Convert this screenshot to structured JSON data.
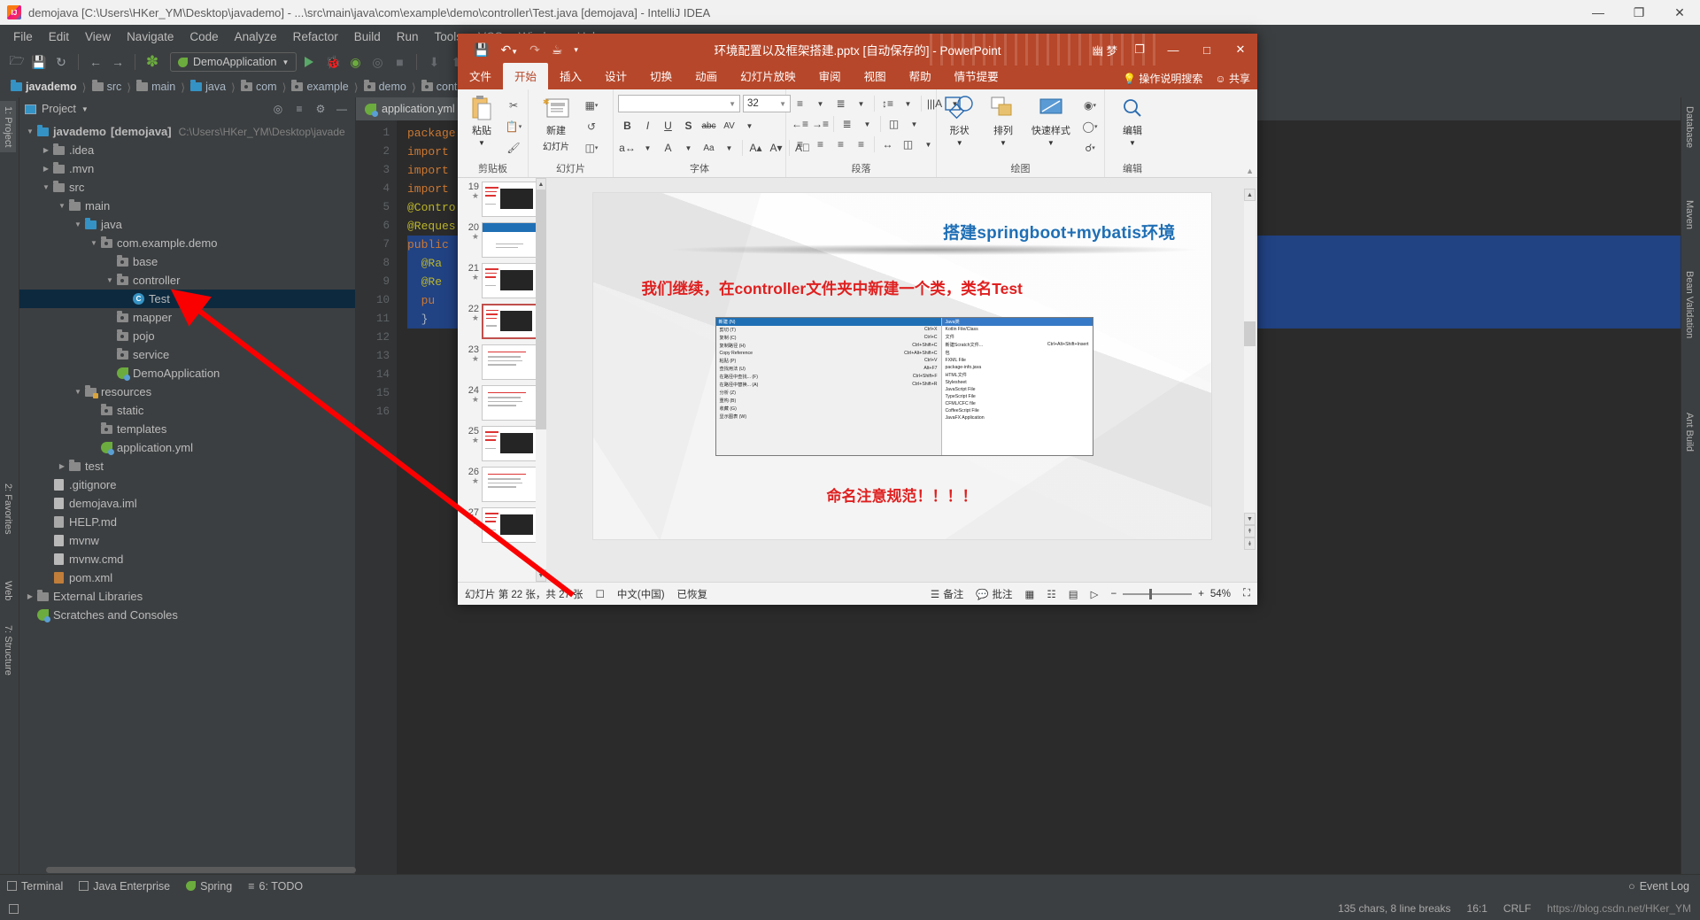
{
  "ide": {
    "title": "demojava [C:\\Users\\HKer_YM\\Desktop\\javademo] - ...\\src\\main\\java\\com\\example\\demo\\controller\\Test.java [demojava] - IntelliJ IDEA",
    "window_buttons": {
      "minimize": "—",
      "maximize": "❐",
      "close": "✕"
    },
    "menus": [
      "File",
      "Edit",
      "View",
      "Navigate",
      "Code",
      "Analyze",
      "Refactor",
      "Build",
      "Run",
      "Tools",
      "VCS",
      "Window",
      "Help"
    ],
    "toolbar": {
      "run_config": "DemoApplication"
    },
    "breadcrumbs": [
      "javademo",
      "src",
      "main",
      "java",
      "com",
      "example",
      "demo",
      "controller"
    ],
    "project_panel": {
      "header": "Project",
      "tree": [
        {
          "depth": 0,
          "arrow": "▼",
          "icon": "module",
          "label": "javademo",
          "bracket": "[demojava]",
          "path": "C:\\Users\\HKer_YM\\Desktop\\javade",
          "bold": true
        },
        {
          "depth": 1,
          "arrow": "▶",
          "icon": "folder",
          "label": ".idea"
        },
        {
          "depth": 1,
          "arrow": "▶",
          "icon": "folder",
          "label": ".mvn"
        },
        {
          "depth": 1,
          "arrow": "▼",
          "icon": "folder",
          "label": "src"
        },
        {
          "depth": 2,
          "arrow": "▼",
          "icon": "folder",
          "label": "main"
        },
        {
          "depth": 3,
          "arrow": "▼",
          "icon": "folder-blue",
          "label": "java"
        },
        {
          "depth": 4,
          "arrow": "▼",
          "icon": "package",
          "label": "com.example.demo"
        },
        {
          "depth": 5,
          "arrow": "",
          "icon": "package",
          "label": "base"
        },
        {
          "depth": 5,
          "arrow": "▼",
          "icon": "package",
          "label": "controller"
        },
        {
          "depth": 6,
          "arrow": "",
          "icon": "class",
          "label": "Test",
          "selected": true
        },
        {
          "depth": 5,
          "arrow": "",
          "icon": "package",
          "label": "mapper"
        },
        {
          "depth": 5,
          "arrow": "",
          "icon": "package",
          "label": "pojo"
        },
        {
          "depth": 5,
          "arrow": "",
          "icon": "package",
          "label": "service"
        },
        {
          "depth": 5,
          "arrow": "",
          "icon": "spring",
          "label": "DemoApplication"
        },
        {
          "depth": 3,
          "arrow": "▼",
          "icon": "resources",
          "label": "resources"
        },
        {
          "depth": 4,
          "arrow": "",
          "icon": "package",
          "label": "static"
        },
        {
          "depth": 4,
          "arrow": "",
          "icon": "package",
          "label": "templates"
        },
        {
          "depth": 4,
          "arrow": "",
          "icon": "spring",
          "label": "application.yml"
        },
        {
          "depth": 2,
          "arrow": "▶",
          "icon": "folder",
          "label": "test"
        },
        {
          "depth": 1,
          "arrow": "",
          "icon": "file",
          "label": ".gitignore"
        },
        {
          "depth": 1,
          "arrow": "",
          "icon": "iml",
          "label": "demojava.iml"
        },
        {
          "depth": 1,
          "arrow": "",
          "icon": "md",
          "label": "HELP.md"
        },
        {
          "depth": 1,
          "arrow": "",
          "icon": "file",
          "label": "mvnw"
        },
        {
          "depth": 1,
          "arrow": "",
          "icon": "file",
          "label": "mvnw.cmd"
        },
        {
          "depth": 1,
          "arrow": "",
          "icon": "xml",
          "label": "pom.xml"
        },
        {
          "depth": 0,
          "arrow": "▶",
          "icon": "lib",
          "label": "External Libraries"
        },
        {
          "depth": 0,
          "arrow": "",
          "icon": "scratch",
          "label": "Scratches and Consoles"
        }
      ]
    },
    "editor": {
      "tab": "application.yml",
      "gutter": [
        "1",
        "2",
        "3",
        "4",
        "5",
        "6",
        "7",
        "8",
        "9",
        "10",
        "11",
        "12",
        "13",
        "14",
        "15",
        "16"
      ],
      "lines": [
        "package",
        "",
        "import",
        "import",
        "import",
        "",
        "@Contro",
        "@Reques",
        "public",
        "  @Ra",
        "  @Re",
        "  pu",
        "",
        "",
        "  }",
        ""
      ]
    },
    "left_rail": [
      "1: Project",
      "2: Favorites",
      "Web",
      "7: Structure"
    ],
    "right_rail": [
      "Database",
      "Maven",
      "Bean Validation",
      "Ant Build"
    ],
    "status_tools": [
      "Terminal",
      "Java Enterprise",
      "Spring",
      "6: TODO"
    ],
    "status_right": "Event Log",
    "status_line": {
      "chars": "135 chars, 8 line breaks",
      "caret": "16:1",
      "lineending": "CRLF",
      "encoding": ""
    },
    "watermark": "https://blog.csdn.net/HKer_YM"
  },
  "ppt": {
    "title": "环境配置以及框架搭建.pptx [自动保存的]  -  PowerPoint",
    "qat": [
      "save-icon",
      "undo-icon",
      "redo-icon",
      "present-icon",
      "more-icon"
    ],
    "user": "幽 梦",
    "window_buttons": {
      "ribbon": "❐",
      "minimize": "—",
      "maximize": "□",
      "close": "✕"
    },
    "tabs": [
      "文件",
      "开始",
      "插入",
      "设计",
      "切换",
      "动画",
      "幻灯片放映",
      "审阅",
      "视图",
      "帮助",
      "情节提要"
    ],
    "active_tab": "开始",
    "tell_me": "操作说明搜索",
    "share": "共享",
    "ribbon_groups": [
      {
        "label": "剪贴板",
        "buttons": [
          "粘贴"
        ]
      },
      {
        "label": "幻灯片",
        "buttons": [
          "新建",
          "幻灯片"
        ]
      },
      {
        "label": "字体",
        "font_name": "",
        "font_size": "32"
      },
      {
        "label": "段落"
      },
      {
        "label": "绘图",
        "buttons": [
          "形状",
          "排列",
          "快速样式"
        ]
      },
      {
        "label": "编辑",
        "buttons": [
          "编辑"
        ]
      }
    ],
    "thumbnails": [
      {
        "num": "19",
        "star": "★",
        "type": "code"
      },
      {
        "num": "20",
        "star": "★",
        "type": "title"
      },
      {
        "num": "21",
        "star": "★",
        "type": "code"
      },
      {
        "num": "22",
        "star": "★",
        "type": "code",
        "active": true
      },
      {
        "num": "23",
        "star": "★",
        "type": "text"
      },
      {
        "num": "24",
        "star": "★",
        "type": "text"
      },
      {
        "num": "25",
        "star": "★",
        "type": "code"
      },
      {
        "num": "26",
        "star": "★",
        "type": "text"
      },
      {
        "num": "27",
        "star": "★",
        "type": "code"
      }
    ],
    "slide": {
      "title": "搭建springboot+mybatis环境",
      "line1": "我们继续，在controller文件夹中新建一个类，类名Test",
      "line2": "命名注意规范！！！！",
      "context_menu": {
        "header": "新建 (N)",
        "left_items": [
          {
            "label": "剪切 (T)",
            "shortcut": "Ctrl+X"
          },
          {
            "label": "复制 (C)",
            "shortcut": "Ctrl+C"
          },
          {
            "label": "复制路径 (H)",
            "shortcut": "Ctrl+Shift+C"
          },
          {
            "label": "Copy Reference",
            "shortcut": "Ctrl+Alt+Shift+C"
          },
          {
            "label": "粘贴 (P)",
            "shortcut": "Ctrl+V"
          },
          {
            "label": "查找用法 (U)",
            "shortcut": "Alt+F7"
          },
          {
            "label": "在路径中查找... (F)",
            "shortcut": "Ctrl+Shift+F"
          },
          {
            "label": "在路径中替换... (A)",
            "shortcut": "Ctrl+Shift+R"
          },
          {
            "label": "分析 (Z)",
            "shortcut": ""
          },
          {
            "label": "重构 (B)",
            "shortcut": ""
          },
          {
            "label": "收藏 (G)",
            "shortcut": ""
          },
          {
            "label": "显示图表 (W)",
            "shortcut": ""
          }
        ],
        "right_items": [
          {
            "label": "Java类",
            "selected": true
          },
          {
            "label": "Kotlin File/Class"
          },
          {
            "label": "文件"
          },
          {
            "label": "新建Scratch文件...",
            "shortcut": "Ctrl+Alt+Shift+Insert"
          },
          {
            "label": "包"
          },
          {
            "label": "FXML File"
          },
          {
            "label": "package-info.java"
          },
          {
            "label": "HTML文件"
          },
          {
            "label": "Stylesheet"
          },
          {
            "label": "JavaScript File"
          },
          {
            "label": "TypeScript File"
          },
          {
            "label": "CFML/CFC file"
          },
          {
            "label": "CoffeeScript File"
          },
          {
            "label": "JavaFX Application"
          }
        ]
      }
    },
    "status": {
      "slide_info": "幻灯片 第 22 张，共 27 张",
      "language": "中文(中国)",
      "recovered": "已恢复",
      "notes": "备注",
      "comments": "批注",
      "zoom": "54%",
      "views": [
        "normal-view",
        "sorter-view",
        "reading-view",
        "slideshow-view"
      ],
      "zoom_out": "−",
      "zoom_in": "+",
      "fit": "fit-to-window-icon"
    }
  },
  "colors": {
    "ppt_accent": "#b7472a",
    "ide_bg": "#3c3f41",
    "editor_bg": "#2b2b2b",
    "selection": "#0d293e",
    "arrow_red": "#fa0000",
    "slide_title_blue": "#1f6fb5",
    "slide_red": "#e02020"
  }
}
